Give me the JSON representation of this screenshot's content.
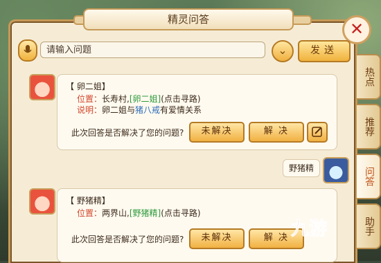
{
  "title": "精灵问答",
  "close_label": "✕",
  "search": {
    "value": "请输入问题"
  },
  "send_label": "发送",
  "side_tabs": [
    "热点",
    "推荐",
    "问答",
    "助手"
  ],
  "qa_cards": [
    {
      "name": "【 卵二姐】",
      "location_label": "位置：",
      "location_text": "长寿村,",
      "location_link": "[卵二姐]",
      "location_hint": "(点击寻路)",
      "desc_label": "说明：",
      "desc_pre": "卵二姐与",
      "desc_link": "猪八戒",
      "desc_post": "有爱情关系",
      "question": "此次回答是否解决了您的问题?",
      "unsolved": "未解决",
      "solved": "解 决"
    },
    {
      "name": "【 野猪精】",
      "location_label": "位置：",
      "location_text": "两界山,",
      "location_link": "[野猪精]",
      "location_hint": "(点击寻路)",
      "question": "此次回答是否解决了您的问题?",
      "unsolved": "未解决",
      "solved": "解 决"
    }
  ],
  "user_message": "野猪精",
  "watermark": "九游"
}
